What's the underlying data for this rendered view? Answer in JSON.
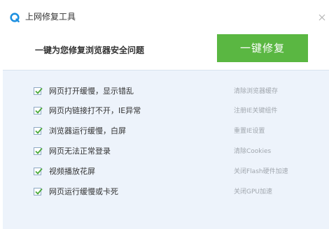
{
  "window": {
    "title": "上网修复工具",
    "close_icon": "close-icon",
    "logo_icon": "qq-browser-logo-icon"
  },
  "header": {
    "headline": "一键为您修复浏览器安全问题",
    "fix_button_label": "一键修复"
  },
  "colors": {
    "accent_green": "#5ab742",
    "check_green": "#4aa93a",
    "logo_blue": "#1c8fe0",
    "content_bg": "#edf3fb",
    "action_text": "#a0a6ad"
  },
  "issues": [
    {
      "label": "网页打开缓慢，显示错乱",
      "action": "清除浏览器缓存",
      "checked": true
    },
    {
      "label": "网页内链接打不开，IE异常",
      "action": "注册IE关键组件",
      "checked": true
    },
    {
      "label": "浏览器运行缓慢，白屏",
      "action": "重置IE设置",
      "checked": true
    },
    {
      "label": "网页无法正常登录",
      "action": "清除Cookies",
      "checked": true
    },
    {
      "label": "视频播放花屏",
      "action": "关闭Flash硬件加速",
      "checked": true
    },
    {
      "label": "网页运行缓慢或卡死",
      "action": "关闭GPU加速",
      "checked": true
    }
  ]
}
